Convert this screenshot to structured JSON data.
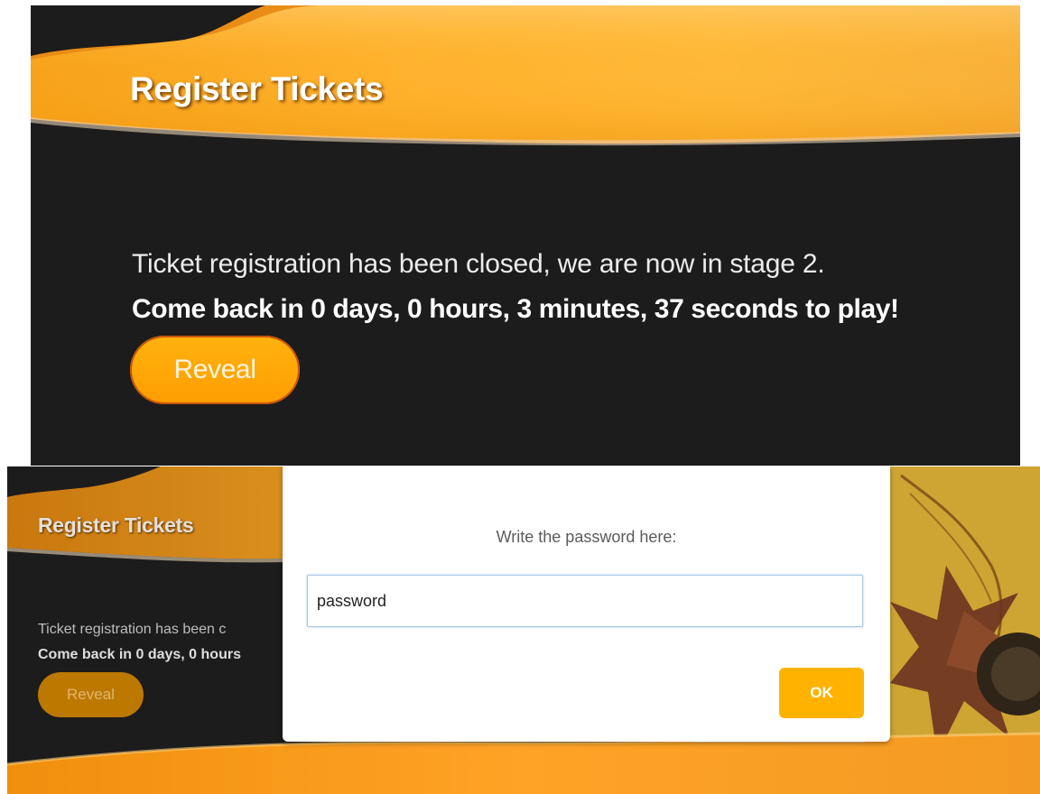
{
  "top": {
    "title": "Register Tickets",
    "message": "Ticket registration has been closed, we are now in stage 2.",
    "countdown": "Come back in 0 days, 0 hours, 3 minutes, 37 seconds to play!",
    "reveal_label": "Reveal"
  },
  "bottom": {
    "title": "Register Tickets",
    "message_partial": "Ticket registration has been c",
    "countdown_partial": "Come back in 0 days, 0 hours",
    "reveal_label": "Reveal"
  },
  "dialog": {
    "label": "Write the password here:",
    "input_value": "password",
    "ok_label": "OK"
  },
  "colors": {
    "panel_background": "#1d1c1c",
    "accent_orange": "#ffa500",
    "ok_button": "#ffb300"
  }
}
